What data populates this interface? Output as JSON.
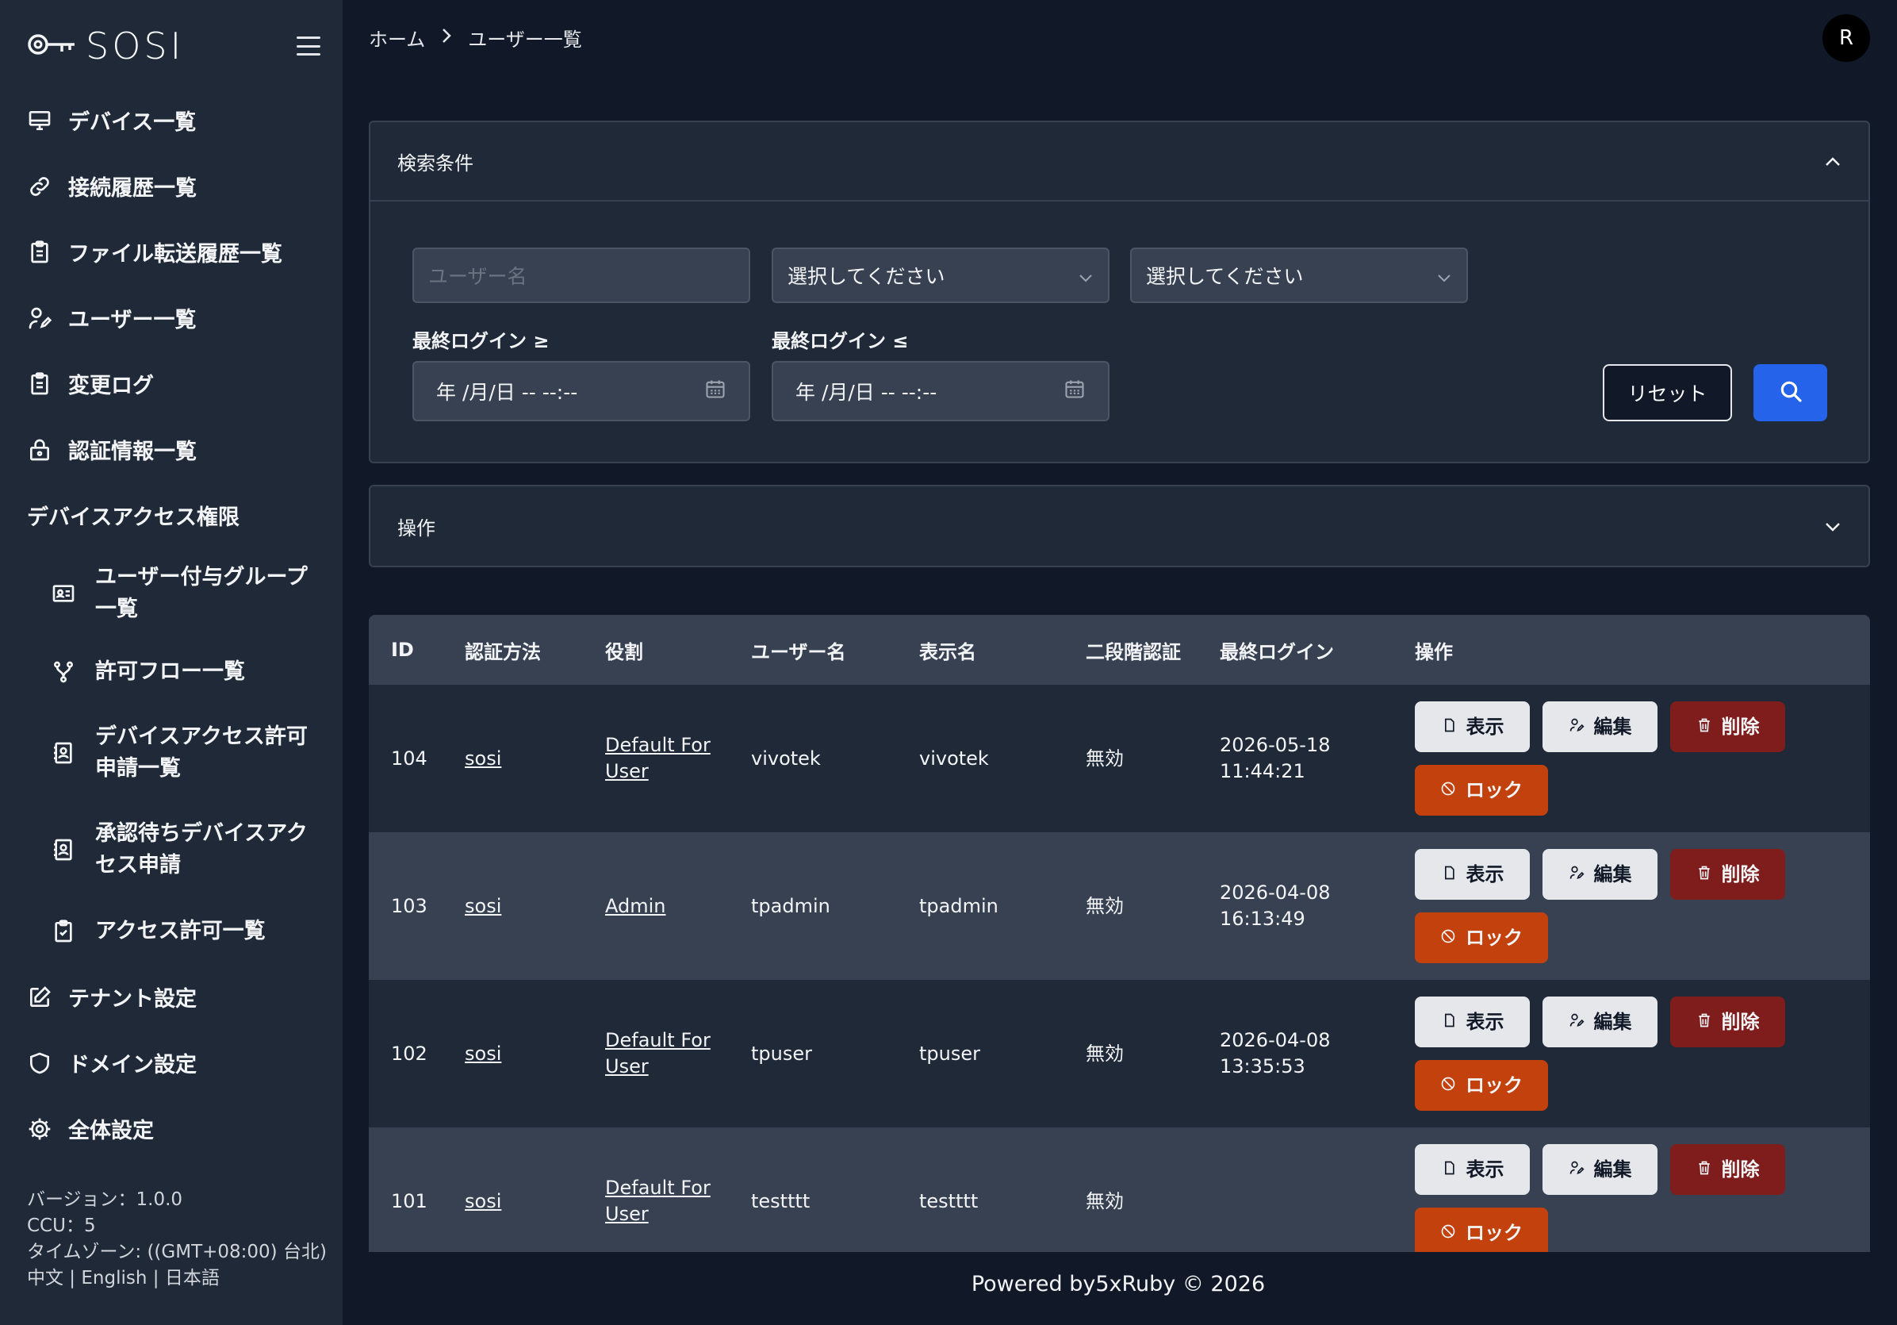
{
  "app": {
    "logo_text": "SOSI"
  },
  "sidebar": {
    "items": [
      {
        "label": "デバイス一覧",
        "icon": "monitor-icon"
      },
      {
        "label": "接続履歴一覧",
        "icon": "link-icon"
      },
      {
        "label": "ファイル転送履歴一覧",
        "icon": "clipboard-list-icon"
      },
      {
        "label": "ユーザー一覧",
        "icon": "user-edit-icon"
      },
      {
        "label": "変更ログ",
        "icon": "clipboard-list-icon"
      },
      {
        "label": "認証情報一覧",
        "icon": "lock-icon"
      }
    ],
    "group_label": "デバイスアクセス権限",
    "sub_items": [
      {
        "label": "ユーザー付与グループ一覧",
        "icon": "id-card-icon"
      },
      {
        "label": "許可フロー一覧",
        "icon": "branch-icon"
      },
      {
        "label": "デバイスアクセス許可申請一覧",
        "icon": "contact-book-icon"
      },
      {
        "label": "承認待ちデバイスアクセス申請",
        "icon": "contact-book-icon"
      },
      {
        "label": "アクセス許可一覧",
        "icon": "clipboard-check-icon"
      }
    ],
    "bottom_items": [
      {
        "label": "テナント設定",
        "icon": "edit-icon"
      },
      {
        "label": "ドメイン設定",
        "icon": "shield-icon"
      },
      {
        "label": "全体設定",
        "icon": "gear-icon"
      }
    ],
    "footer": {
      "version": "バージョン：1.0.0",
      "ccu": "CCU：5",
      "timezone": "タイムゾーン: ((GMT+08:00) 台北)",
      "lang_zh": "中文",
      "lang_en": "English",
      "lang_ja": "日本語",
      "sep": " | "
    }
  },
  "breadcrumb": {
    "home": "ホーム",
    "separator": "›",
    "current": "ユーザー一覧"
  },
  "user": {
    "avatar_initial": "R"
  },
  "search": {
    "title": "検索条件",
    "username_placeholder": "ユーザー名",
    "select1": "選択してください",
    "select2": "選択してください",
    "last_login_from_label": "最終ログイン ≥",
    "last_login_to_label": "最終ログイン ≤",
    "date_placeholder": "年 /月/日 -- --:--",
    "reset_label": "リセット"
  },
  "operations": {
    "title": "操作"
  },
  "table": {
    "headers": [
      "ID",
      "認証方法",
      "役割",
      "ユーザー名",
      "表示名",
      "二段階認証",
      "最終ログイン",
      "操作"
    ],
    "rows": [
      {
        "id": "104",
        "auth": "sosi",
        "role": "Default For User",
        "username": "vivotek",
        "display": "vivotek",
        "twofa": "無効",
        "last_login": "2026-05-18 11:44:21"
      },
      {
        "id": "103",
        "auth": "sosi",
        "role": "Admin",
        "username": "tpadmin",
        "display": "tpadmin",
        "twofa": "無効",
        "last_login": "2026-04-08 16:13:49"
      },
      {
        "id": "102",
        "auth": "sosi",
        "role": "Default For User",
        "username": "tpuser",
        "display": "tpuser",
        "twofa": "無効",
        "last_login": "2026-04-08 13:35:53"
      },
      {
        "id": "101",
        "auth": "sosi",
        "role": "Default For User",
        "username": "testttt",
        "display": "testttt",
        "twofa": "無効",
        "last_login": ""
      }
    ],
    "actions": {
      "view": "表示",
      "edit": "編集",
      "delete": "削除",
      "lock": "ロック"
    }
  },
  "footer": {
    "text": "Powered by5xRuby © 2026"
  }
}
